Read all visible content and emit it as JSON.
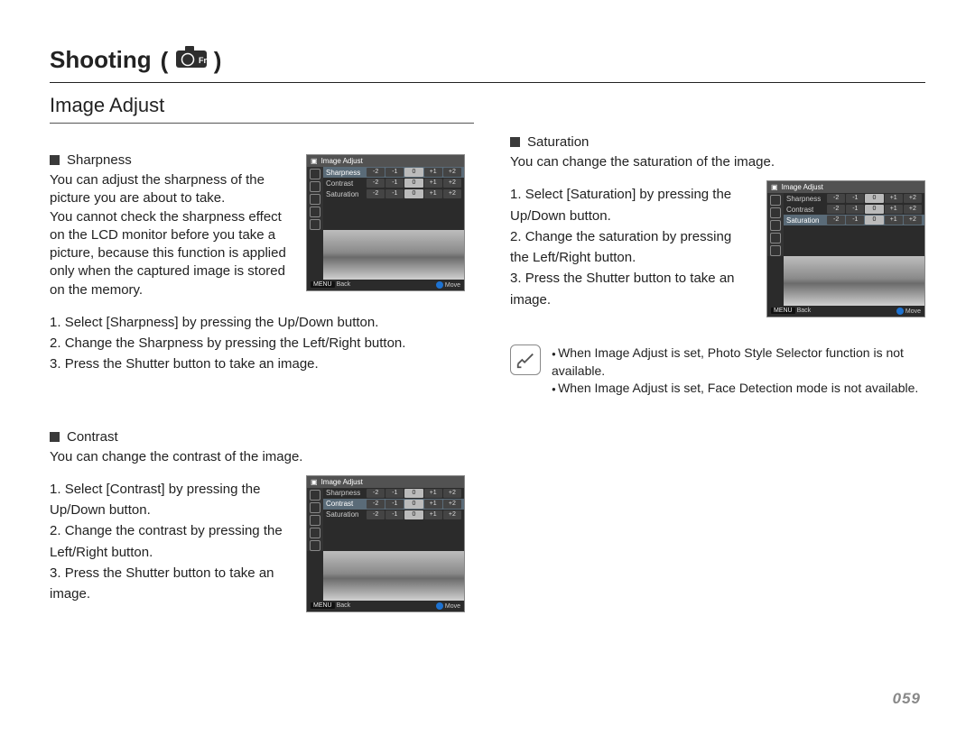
{
  "chapter": {
    "title": "Shooting"
  },
  "section": {
    "title": "Image Adjust"
  },
  "pageNumber": "059",
  "sharpness": {
    "heading": "Sharpness",
    "para": "You can adjust the sharpness of the picture you are about to take.\nYou cannot check the sharpness effect on the LCD monitor before you take a picture, because this function is applied only when the captured image is stored on the memory.",
    "steps": [
      "Select [Sharpness] by pressing the Up/Down button.",
      "Change the Sharpness by pressing the Left/Right button.",
      "Press the Shutter button to take an image."
    ]
  },
  "contrast": {
    "heading": "Contrast",
    "para": "You can change the contrast of the image.",
    "steps": [
      "Select [Contrast] by pressing the Up/Down button.",
      "Change the contrast by pressing the Left/Right button.",
      "Press the Shutter button to take an image."
    ]
  },
  "saturation": {
    "heading": "Saturation",
    "para": "You can change the saturation of the image.",
    "steps": [
      "Select [Saturation] by pressing the Up/Down button.",
      "Change the saturation by pressing the Left/Right button.",
      "Press the Shutter button to take an image."
    ]
  },
  "notes": [
    "When Image Adjust  is set, Photo Style Selector function is not available.",
    "When Image Adjust is set, Face Detection mode is not available."
  ],
  "shot": {
    "title": "Image Adjust",
    "rows": [
      {
        "label": "Sharpness"
      },
      {
        "label": "Contrast"
      },
      {
        "label": "Saturation"
      }
    ],
    "scale": [
      "-2",
      "-1",
      "0",
      "+1",
      "+2"
    ],
    "bottom": {
      "menu": "MENU",
      "back": "Back",
      "move": "Move"
    }
  }
}
